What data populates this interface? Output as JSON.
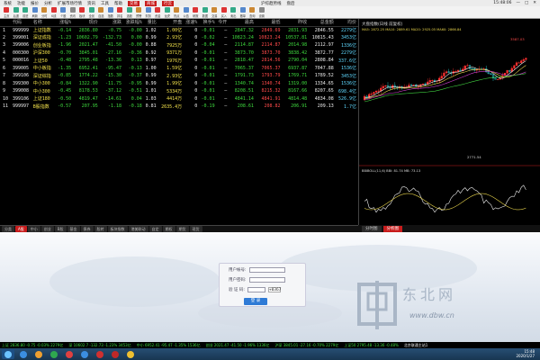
{
  "titlebar": {
    "menu": [
      {
        "label": "系统",
        "hl": false
      },
      {
        "label": "功能",
        "hl": false
      },
      {
        "label": "报价",
        "hl": false
      },
      {
        "label": "分析",
        "hl": false
      },
      {
        "label": "扩展市场行情",
        "hl": false
      },
      {
        "label": "资讯",
        "hl": false
      },
      {
        "label": "工具",
        "hl": false
      },
      {
        "label": "帮助",
        "hl": false
      },
      {
        "label": "交易",
        "hl": true
      },
      {
        "label": "商城",
        "hl": true
      },
      {
        "label": "行云",
        "hl": true
      }
    ],
    "center": [
      "沪综趋势线",
      "盘后"
    ],
    "time": "15:48:06"
  },
  "toolbar": {
    "buttons": [
      {
        "label": "主页",
        "color": "#d33"
      },
      {
        "label": "后退",
        "color": "#3a8"
      },
      {
        "label": "前进",
        "color": "#3a8"
      },
      {
        "label": "刷新",
        "color": "#58c"
      },
      {
        "label": "分时",
        "color": "#c83"
      },
      {
        "label": "K线",
        "color": "#d33"
      },
      {
        "label": "个股",
        "color": "#58c"
      },
      {
        "label": "资讯",
        "color": "#888"
      },
      {
        "label": "板块",
        "color": "#d33"
      },
      {
        "label": "全景",
        "color": "#3a8"
      },
      {
        "label": "自选",
        "color": "#c83"
      },
      {
        "label": "指数",
        "color": "#58c"
      },
      {
        "label": "排名",
        "color": "#d33"
      },
      {
        "label": "选股",
        "color": "#3a8"
      },
      {
        "label": "预警",
        "color": "#c83"
      },
      {
        "label": "财务",
        "color": "#58c"
      },
      {
        "label": "资金",
        "color": "#d33"
      },
      {
        "label": "龙虎",
        "color": "#3a8"
      },
      {
        "label": "热点",
        "color": "#c83"
      },
      {
        "label": "公告",
        "color": "#58c"
      },
      {
        "label": "研报",
        "color": "#d33"
      },
      {
        "label": "数据",
        "color": "#3a8"
      },
      {
        "label": "交易",
        "color": "#c83"
      },
      {
        "label": "买入",
        "color": "#d33"
      },
      {
        "label": "卖出",
        "color": "#3a8"
      },
      {
        "label": "撤单",
        "color": "#58c"
      },
      {
        "label": "查询",
        "color": "#c83"
      },
      {
        "label": "设置",
        "color": "#888"
      }
    ]
  },
  "quote": {
    "headers": [
      "",
      "代码",
      "名称",
      "涨幅%",
      "现价",
      "涨跌",
      "涨跌幅%",
      "量比",
      "开盘",
      "涨速%",
      "换手%",
      "今开",
      "最高",
      "最低",
      "昨收",
      "总金额",
      "均价"
    ],
    "rows": [
      {
        "n": "1",
        "code": "999999",
        "name": "上证指数",
        "pct": "-0.14",
        "price": "2836.80",
        "chg": "-0.75",
        "a": "-0.00",
        "b": "1.02",
        "c": "1.00亿",
        "d": "0",
        "e": "-0.01",
        "f": "—",
        "g": "2847.32",
        "h": "2849.69",
        "i": "2831.93",
        "j": "2846.55",
        "k": "2279亿",
        "t": "dn"
      },
      {
        "n": "2",
        "code": "399001",
        "name": "深证成指",
        "pct": "-1.23",
        "price": "10602.79",
        "chg": "-132.73",
        "a": "0.00",
        "b": "0.99",
        "c": "2.93亿",
        "d": "0",
        "e": "-0.02",
        "f": "—",
        "g": "10823.24",
        "h": "10823.24",
        "i": "10537.81",
        "j": "10815.43",
        "k": "3453亿",
        "t": "dn"
      },
      {
        "n": "3",
        "code": "399006",
        "name": "创业板指",
        "pct": "-1.96",
        "price": "2021.47",
        "chg": "-41.50",
        "a": "-0.00",
        "b": "0.88",
        "c": "7925万",
        "d": "0",
        "e": "-0.04",
        "f": "—",
        "g": "2114.87",
        "h": "2114.87",
        "i": "2014.98",
        "j": "2112.97",
        "k": "1336亿",
        "t": "dn"
      },
      {
        "n": "4",
        "code": "000300",
        "name": "沪深300",
        "pct": "-0.70",
        "price": "3845.01",
        "chg": "-27.16",
        "a": "-0.36",
        "b": "0.92",
        "c": "9371万",
        "d": "0",
        "e": "-0.01",
        "f": "—",
        "g": "3873.70",
        "h": "3873.70",
        "i": "3838.42",
        "j": "3872.77",
        "k": "2279亿",
        "t": "dn"
      },
      {
        "n": "5",
        "code": "000016",
        "name": "上证50",
        "pct": "-0.48",
        "price": "2795.48",
        "chg": "-13.36",
        "a": "0.13",
        "b": "0.97",
        "c": "1976万",
        "d": "0",
        "e": "-0.01",
        "f": "—",
        "g": "2818.47",
        "h": "2814.56",
        "i": "2790.04",
        "j": "2808.84",
        "k": "337.6亿",
        "t": "dn"
      },
      {
        "n": "6",
        "code": "399005",
        "name": "中小板指",
        "pct": "-1.35",
        "price": "6952.41",
        "chg": "-95.47",
        "a": "-0.13",
        "b": "1.00",
        "c": "1.59亿",
        "d": "0",
        "e": "-0.01",
        "f": "—",
        "g": "7065.37",
        "h": "7065.37",
        "i": "6937.87",
        "j": "7047.88",
        "k": "1536亿",
        "t": "dn"
      },
      {
        "n": "7",
        "code": "399106",
        "name": "深证综指",
        "pct": "-0.85",
        "price": "1774.22",
        "chg": "-15.30",
        "a": "-0.37",
        "b": "0.99",
        "c": "2.93亿",
        "d": "0",
        "e": "-0.01",
        "f": "—",
        "g": "1791.73",
        "h": "1793.79",
        "i": "1769.71",
        "j": "1789.52",
        "k": "3453亿",
        "t": "dn"
      },
      {
        "n": "8",
        "code": "399300",
        "name": "中小300",
        "pct": "-0.84",
        "price": "1322.90",
        "chg": "-11.75",
        "a": "-0.95",
        "b": "0.99",
        "c": "1.99亿",
        "d": "0",
        "e": "-0.01",
        "f": "—",
        "g": "1340.74",
        "h": "1340.74",
        "i": "1319.00",
        "j": "1334.65",
        "k": "1536亿",
        "t": "dn"
      },
      {
        "n": "9",
        "code": "399008",
        "name": "中小300",
        "pct": "-0.45",
        "price": "8178.53",
        "chg": "-37.12",
        "a": "-0.51",
        "b": "1.01",
        "c": "5334万",
        "d": "0",
        "e": "-0.01",
        "f": "—",
        "g": "8208.51",
        "h": "8215.32",
        "i": "8167.66",
        "j": "8207.65",
        "k": "698.4亿",
        "t": "dn"
      },
      {
        "n": "10",
        "code": "399106",
        "name": "上证180",
        "pct": "-0.50",
        "price": "4819.47",
        "chg": "-14.61",
        "a": "0.04",
        "b": "1.03",
        "c": "4414万",
        "d": "0",
        "e": "-0.01",
        "f": "—",
        "g": "4841.14",
        "h": "4841.91",
        "i": "4814.48",
        "j": "4834.08",
        "k": "526.9亿",
        "t": "dn"
      },
      {
        "n": "11",
        "code": "999997",
        "name": "B股指数",
        "pct": "-0.57",
        "price": "207.95",
        "chg": "-1.18",
        "a": "-0.18",
        "b": "0.81",
        "c": "2635.4万",
        "d": "0",
        "e": "-0.19",
        "f": "—",
        "g": "208.61",
        "h": "208.82",
        "i": "206.91",
        "j": "209.13",
        "k": "1.7亿",
        "t": "dn"
      }
    ]
  },
  "bottom_tabs": [
    {
      "label": "分类",
      "act": false
    },
    {
      "label": "A股",
      "act": true
    },
    {
      "label": "中小",
      "act": false
    },
    {
      "label": "创业",
      "act": false
    },
    {
      "label": "B股",
      "act": false
    },
    {
      "label": "基金",
      "act": false
    },
    {
      "label": "债券",
      "act": false
    },
    {
      "label": "股转",
      "act": false
    },
    {
      "label": "板块指数",
      "act": false
    },
    {
      "label": "港美联动",
      "act": false
    },
    {
      "label": "自定",
      "act": false
    },
    {
      "label": "期权",
      "act": false
    },
    {
      "label": "期货",
      "act": false
    },
    {
      "label": "现货",
      "act": false
    }
  ],
  "chart_panel": {
    "title": "大盘指数(日线 前复权)",
    "ma_legend": "MA5: 2872.25  MA10: 2889.61  MA20: 2925.05  MA60: 2866.84",
    "sub_title": "BBIBOLL(11,6)  BBI: 81.74  MB: 73.13",
    "price_labels": [
      "3587.03",
      "2771.54"
    ],
    "tabs": [
      {
        "label": "分时图",
        "act": false
      },
      {
        "label": "分析图",
        "act": true
      }
    ]
  },
  "login": {
    "user_label": "用户帐号:",
    "pass_label": "用户密码:",
    "code_label": "验 证 码:",
    "captcha": "+0367",
    "button": "登 录"
  },
  "watermark": {
    "cn": "东北网",
    "url": "www.dbw.cn"
  },
  "statusbar": [
    "上证 2836.80  -0.75  -0.03%  2279亿",
    "深 10602.7  -132.73  -1.23%  3453亿",
    "中小 6952.41  -95.47  -1.35%  1536亿",
    "创业 2021.47  -41.50  -1.96%  1336亿",
    "沪深 3845.01  -27.16  -0.70%  2279亿",
    "上证50  2795.48  -13.36  -0.48%",
    "北京联通主站1"
  ],
  "taskbar": {
    "apps": [
      "#3b8ee0",
      "#f0a030",
      "#2fa84f",
      "#e04040",
      "#3b8ee0",
      "#d03030",
      "#c02828",
      "#f0c030"
    ],
    "time": "15:48",
    "date": "2020/1/27"
  }
}
